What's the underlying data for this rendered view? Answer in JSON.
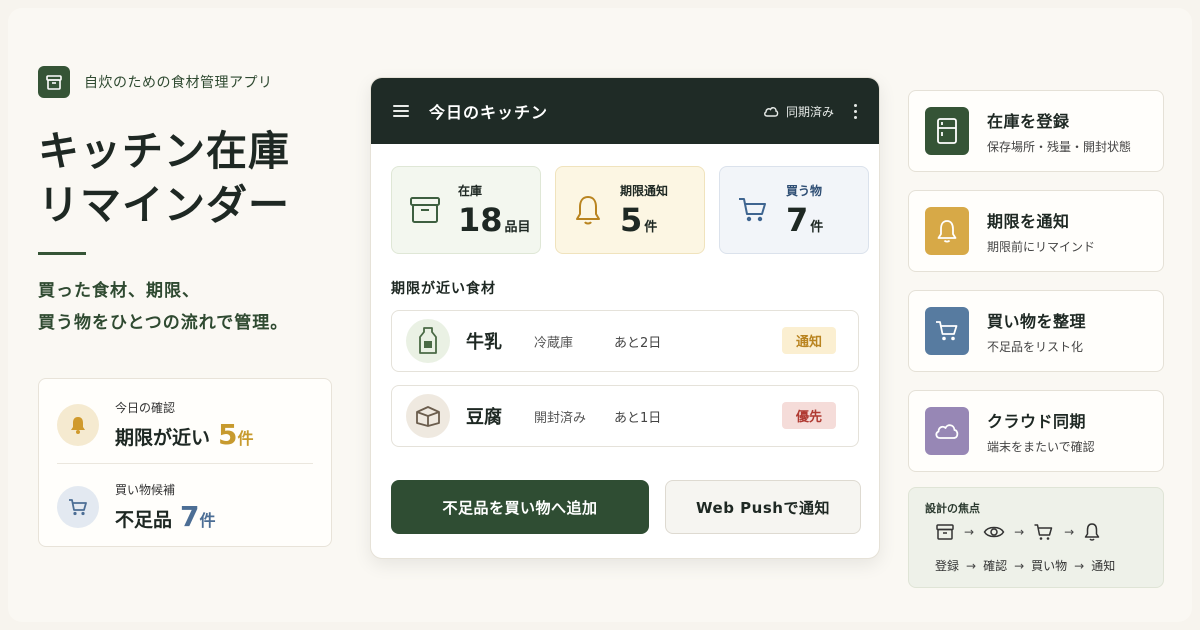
{
  "brand": {
    "label": "自炊のための食材管理アプリ",
    "icon": "box-icon"
  },
  "hero": {
    "title_line1": "キッチン在庫",
    "title_line2": "リマインダー",
    "sub_line1": "買った食材、期限、",
    "sub_line2": "買う物をひとつの流れで管理。"
  },
  "summary": {
    "row1": {
      "small": "今日の確認",
      "big": "期限が近い",
      "num": "5",
      "unit": "件",
      "icon": "bell-icon"
    },
    "row2": {
      "small": "買い物候補",
      "big": "不足品",
      "num": "7",
      "unit": "件",
      "icon": "cart-icon"
    }
  },
  "panel": {
    "title": "今日のキッチン",
    "sync_label": "同期済み",
    "stats": [
      {
        "label": "在庫",
        "num": "18",
        "unit": "品目",
        "icon": "box-icon"
      },
      {
        "label": "期限通知",
        "num": "5",
        "unit": "件",
        "icon": "bell-icon"
      },
      {
        "label": "買う物",
        "num": "7",
        "unit": "件",
        "icon": "cart-icon"
      }
    ],
    "section_title": "期限が近い食材",
    "items": [
      {
        "name": "牛乳",
        "location": "冷蔵庫",
        "remaining": "あと2日",
        "badge": "通知",
        "icon": "milk-icon"
      },
      {
        "name": "豆腐",
        "location": "開封済み",
        "remaining": "あと1日",
        "badge": "優先",
        "icon": "tofu-icon"
      }
    ],
    "primary_button": "不足品を買い物へ追加",
    "secondary_button": "Web Pushで通知"
  },
  "features": [
    {
      "title": "在庫を登録",
      "sub": "保存場所・残量・開封状態",
      "icon": "fridge-icon",
      "color": "#355436"
    },
    {
      "title": "期限を通知",
      "sub": "期限前にリマインド",
      "icon": "bell-icon",
      "color": "#d7a947"
    },
    {
      "title": "買い物を整理",
      "sub": "不足品をリスト化",
      "icon": "cart-icon",
      "color": "#577ba0"
    },
    {
      "title": "クラウド同期",
      "sub": "端末をまたいで確認",
      "icon": "cloud-icon",
      "color": "#9787b5"
    }
  ],
  "focus": {
    "title": "設計の焦点",
    "steps": [
      "登録",
      "確認",
      "買い物",
      "通知"
    ],
    "arrow": "→"
  },
  "colors": {
    "brand_green": "#355436",
    "accent_yellow": "#c79a2e",
    "accent_blue": "#4c6e95",
    "header_dark": "#1f2b26"
  }
}
